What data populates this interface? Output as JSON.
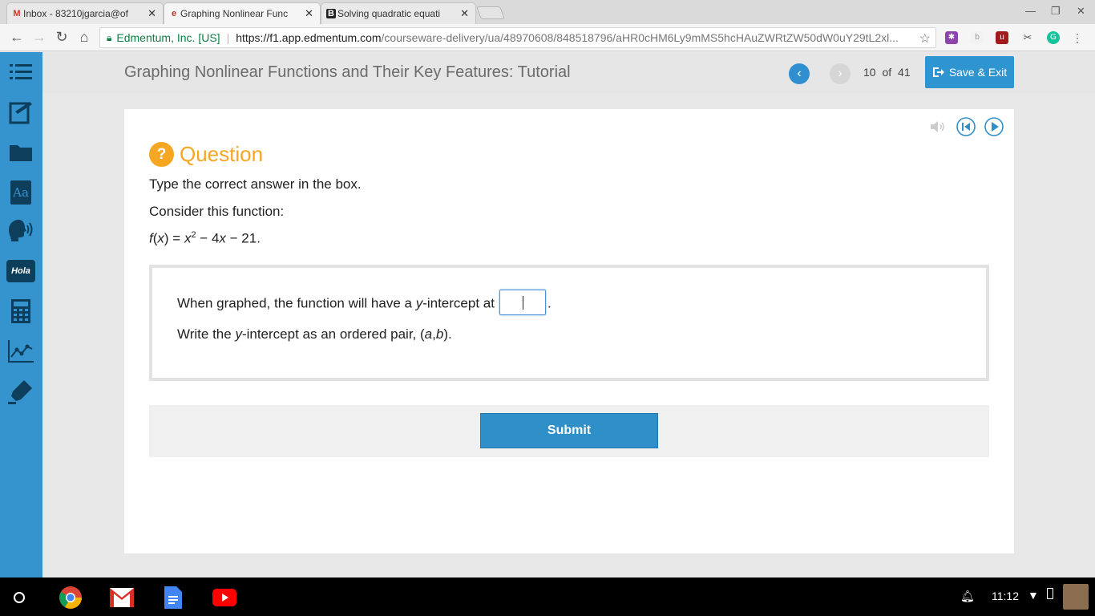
{
  "browser": {
    "tabs": [
      {
        "label": "Inbox - 83210jgarcia@of",
        "icon": "gmail-icon"
      },
      {
        "label": "Graphing Nonlinear Func",
        "icon": "edmentum-icon"
      },
      {
        "label": "Solving quadratic equati",
        "icon": "brainly-icon"
      }
    ],
    "address": {
      "org": "Edmentum, Inc. [US]",
      "host": "https://f1.app.edmentum.com",
      "path": "/courseware-delivery/ua/48970608/848518796/aHR0cHM6Ly9mMS5hcHAuZWRtZW50dW0uY29tL2xl..."
    }
  },
  "header": {
    "title": "Graphing Nonlinear Functions and Their Key Features: Tutorial",
    "page_current": "10",
    "page_of": "of",
    "page_total": "41",
    "save_label": "Save & Exit"
  },
  "sidebar": {
    "items": [
      "list-icon",
      "notes-icon",
      "folder-icon",
      "dictionary-icon",
      "speech-icon",
      "translate-icon",
      "calculator-icon",
      "graph-icon",
      "highlighter-icon"
    ],
    "hola": "Hola",
    "aa": "Aa"
  },
  "question": {
    "title": "Question",
    "mark": "?",
    "instruction": "Type the correct answer in the box.",
    "consider": "Consider this function:",
    "function_f": "f",
    "function_x": "x",
    "function_eq": " = ",
    "function_x2": "x",
    "function_exp": "2",
    "function_rest": " − 4",
    "function_x3": "x",
    "function_end": " − 21.",
    "line1_pre": "When graphed, the function will have a ",
    "line1_y": "y",
    "line1_post": "-intercept at",
    "line1_period": ".",
    "line2_pre": "Write the ",
    "line2_y": "y",
    "line2_mid": "-intercept as an ordered pair, (",
    "line2_a": "a",
    "line2_comma": ",",
    "line2_b": "b",
    "line2_end": ").",
    "submit_label": "Submit",
    "answer_value": ""
  },
  "taskbar": {
    "time": "11:12"
  },
  "colors": {
    "sidebar": "#3593cd",
    "accent": "#f5a623",
    "button": "#2f8fc8"
  }
}
